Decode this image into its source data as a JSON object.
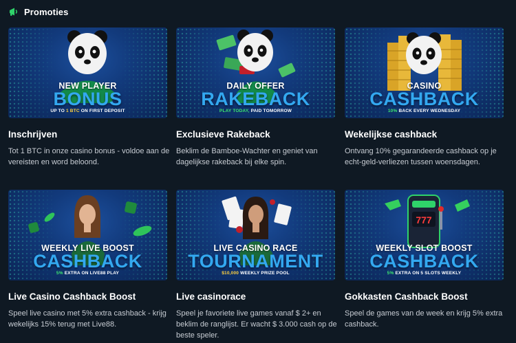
{
  "header": {
    "title": "Promoties",
    "icon": "megaphone-icon",
    "accent": "#2fd36a"
  },
  "cards": [
    {
      "banner": {
        "line1": "NEW PLAYER",
        "line2": "BONUS",
        "sub_a": "UP TO ",
        "sub_b": "1 BTC",
        "sub_c": " ON FIRST DEPOSIT"
      },
      "title": "Inschrijven",
      "desc": "Tot 1 BTC in onze casino bonus - voldoe aan de vereisten en word beloond."
    },
    {
      "banner": {
        "line1": "DAILY OFFER",
        "line2": "RAKEBACK",
        "sub_a": "PLAY TODAY, ",
        "sub_b": "PAID TOMORROW"
      },
      "title": "Exclusieve Rakeback",
      "desc": "Beklim de Bamboe-Wachter en geniet van dagelijkse rakeback bij elke spin."
    },
    {
      "banner": {
        "line1": "CASINO",
        "line2": "CASHBACK",
        "sub_a": "10% ",
        "sub_b": "BACK EVERY WEDNESDAY"
      },
      "title": "Wekelijkse cashback",
      "desc": "Ontvang 10% gegarandeerde cashback op je echt-geld-verliezen tussen woensdagen."
    },
    {
      "banner": {
        "line1": "WEEKLY LIVE BOOST",
        "line2": "CASHBACK",
        "sub_a": "5% ",
        "sub_b": "EXTRA ON LIVE88 PLAY"
      },
      "title": "Live Casino Cashback Boost",
      "desc": "Speel live casino met 5% extra cashback - krijg wekelijks 15% terug met Live88."
    },
    {
      "banner": {
        "line1": "LIVE CASINO RACE",
        "line2": "TOURNAMENT",
        "sub_a": "$10,000 ",
        "sub_b": "WEEKLY PRIZE POOL"
      },
      "title": "Live casinorace",
      "desc": "Speel je favoriete live games vanaf $ 2+ en beklim de ranglijst. Er wacht $ 3.000 cash op de beste speler."
    },
    {
      "banner": {
        "line1": "WEEKLY SLOT BOOST",
        "line2": "CASHBACK",
        "sub_a": "5% ",
        "sub_b": "EXTRA ON 5 SLOTS WEEKLY"
      },
      "title": "Gokkasten Cashback Boost",
      "desc": "Speel de games van de week en krijg 5% extra cashback."
    }
  ]
}
